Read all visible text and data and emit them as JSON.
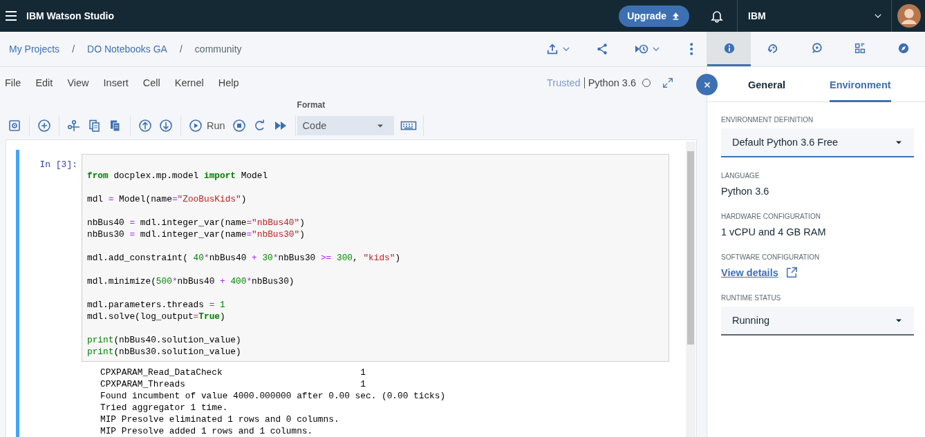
{
  "header": {
    "app_title": "IBM Watson Studio",
    "upgrade_button": "Upgrade",
    "account": "IBM"
  },
  "breadcrumbs": [
    {
      "kind": "link",
      "label": "My Projects"
    },
    {
      "kind": "separator",
      "label": "/"
    },
    {
      "kind": "link",
      "label": "DO Notebooks GA"
    },
    {
      "kind": "separator",
      "label": "/"
    },
    {
      "kind": "current",
      "label": "community"
    }
  ],
  "project_actions": [
    {
      "kind": "upload"
    },
    {
      "kind": "share"
    },
    {
      "kind": "history"
    },
    {
      "kind": "more"
    }
  ],
  "panel_icon_tabs": [
    {
      "kind": "info",
      "selected": true
    },
    {
      "kind": "refresh",
      "selected": false
    },
    {
      "kind": "chat",
      "selected": false
    },
    {
      "kind": "grid",
      "selected": false
    },
    {
      "kind": "compass",
      "selected": false
    }
  ],
  "menu": [
    "File",
    "Edit",
    "View",
    "Insert",
    "Cell",
    "Kernel",
    "Help"
  ],
  "kernel_status": {
    "trust": "Trusted",
    "kernel": "Python 3.6",
    "busy": false
  },
  "toolbar": {
    "format_label": "Format",
    "cell_type": "Code",
    "groups": [
      [
        {
          "kind": "save"
        }
      ],
      [
        {
          "kind": "add"
        }
      ],
      [
        {
          "kind": "cut"
        },
        {
          "kind": "copy"
        },
        {
          "kind": "paste"
        }
      ],
      [
        {
          "kind": "up"
        },
        {
          "kind": "down"
        }
      ],
      [
        {
          "kind": "run",
          "label": "Run"
        },
        {
          "kind": "stop"
        },
        {
          "kind": "restart"
        },
        {
          "kind": "run-all"
        }
      ]
    ]
  },
  "cell": {
    "prompt": "In [3]:",
    "selected": true,
    "code_blocks": [
      [
        [
          {
            "kind": "keyword",
            "text": "from"
          },
          {
            "kind": "plain",
            "text": " docplex.mp.model "
          },
          {
            "kind": "keyword",
            "text": "import"
          },
          {
            "kind": "plain",
            "text": " Model"
          }
        ]
      ],
      [
        [
          {
            "kind": "plain",
            "text": "mdl "
          },
          {
            "kind": "operator",
            "text": "="
          },
          {
            "kind": "plain",
            "text": " Model(name"
          },
          {
            "kind": "operator",
            "text": "="
          },
          {
            "kind": "string",
            "text": "\"ZooBusKids\""
          },
          {
            "kind": "plain",
            "text": ")"
          }
        ]
      ],
      [
        [
          {
            "kind": "plain",
            "text": "nbBus40 "
          },
          {
            "kind": "operator",
            "text": "="
          },
          {
            "kind": "plain",
            "text": " mdl.integer_var(name"
          },
          {
            "kind": "operator",
            "text": "="
          },
          {
            "kind": "string",
            "text": "\"nbBus40\""
          },
          {
            "kind": "plain",
            "text": ")"
          }
        ],
        [
          {
            "kind": "plain",
            "text": "nbBus30 "
          },
          {
            "kind": "operator",
            "text": "="
          },
          {
            "kind": "plain",
            "text": " mdl.integer_var(name"
          },
          {
            "kind": "operator",
            "text": "="
          },
          {
            "kind": "string",
            "text": "\"nbBus30\""
          },
          {
            "kind": "plain",
            "text": ")"
          }
        ]
      ],
      [
        [
          {
            "kind": "plain",
            "text": "mdl.add_constraint( "
          },
          {
            "kind": "number",
            "text": "40"
          },
          {
            "kind": "operator",
            "text": "*"
          },
          {
            "kind": "plain",
            "text": "nbBus40 "
          },
          {
            "kind": "operator",
            "text": "+"
          },
          {
            "kind": "number",
            "text": " 30"
          },
          {
            "kind": "operator",
            "text": "*"
          },
          {
            "kind": "plain",
            "text": "nbBus30 "
          },
          {
            "kind": "operator",
            "text": ">="
          },
          {
            "kind": "number",
            "text": " 300"
          },
          {
            "kind": "plain",
            "text": ", "
          },
          {
            "kind": "string",
            "text": "\"kids\""
          },
          {
            "kind": "plain",
            "text": ")"
          }
        ]
      ],
      [
        [
          {
            "kind": "plain",
            "text": "mdl.minimize("
          },
          {
            "kind": "number",
            "text": "500"
          },
          {
            "kind": "operator",
            "text": "*"
          },
          {
            "kind": "plain",
            "text": "nbBus40 "
          },
          {
            "kind": "operator",
            "text": "+"
          },
          {
            "kind": "number",
            "text": " 400"
          },
          {
            "kind": "operator",
            "text": "*"
          },
          {
            "kind": "plain",
            "text": "nbBus30)"
          }
        ]
      ],
      [
        [
          {
            "kind": "plain",
            "text": "mdl.parameters.threads "
          },
          {
            "kind": "operator",
            "text": "="
          },
          {
            "kind": "number",
            "text": " 1"
          }
        ],
        [
          {
            "kind": "plain",
            "text": "mdl.solve(log_output"
          },
          {
            "kind": "operator",
            "text": "="
          },
          {
            "kind": "keyword",
            "text": "True"
          },
          {
            "kind": "plain",
            "text": ")"
          }
        ]
      ],
      [
        [
          {
            "kind": "builtin",
            "text": "print"
          },
          {
            "kind": "plain",
            "text": "(nbBus40.solution_value)"
          }
        ],
        [
          {
            "kind": "builtin",
            "text": "print"
          },
          {
            "kind": "plain",
            "text": "(nbBus30.solution_value)"
          }
        ]
      ]
    ],
    "output": [
      "CPXPARAM_Read_DataCheck                          1",
      "CPXPARAM_Threads                                 1",
      "Found incumbent of value 4000.000000 after 0.00 sec. (0.00 ticks)",
      "Tried aggregator 1 time.",
      "MIP Presolve eliminated 1 rows and 0 columns.",
      "MIP Presolve added 1 rows and 1 columns."
    ]
  },
  "panel": {
    "tabs": [
      {
        "label": "General",
        "selected": false
      },
      {
        "label": "Environment",
        "selected": true
      }
    ],
    "fields": [
      {
        "kind": "select",
        "label": "ENVIRONMENT DEFINITION",
        "value": "Default Python 3.6 Free",
        "focused": true
      },
      {
        "kind": "text",
        "label": "LANGUAGE",
        "value": "Python 3.6"
      },
      {
        "kind": "text",
        "label": "HARDWARE CONFIGURATION",
        "value": "1 vCPU and 4 GB RAM"
      },
      {
        "kind": "link",
        "label": "SOFTWARE CONFIGURATION",
        "value": "View details"
      },
      {
        "kind": "select",
        "label": "RUNTIME STATUS",
        "value": "Running",
        "focused": false
      }
    ]
  }
}
